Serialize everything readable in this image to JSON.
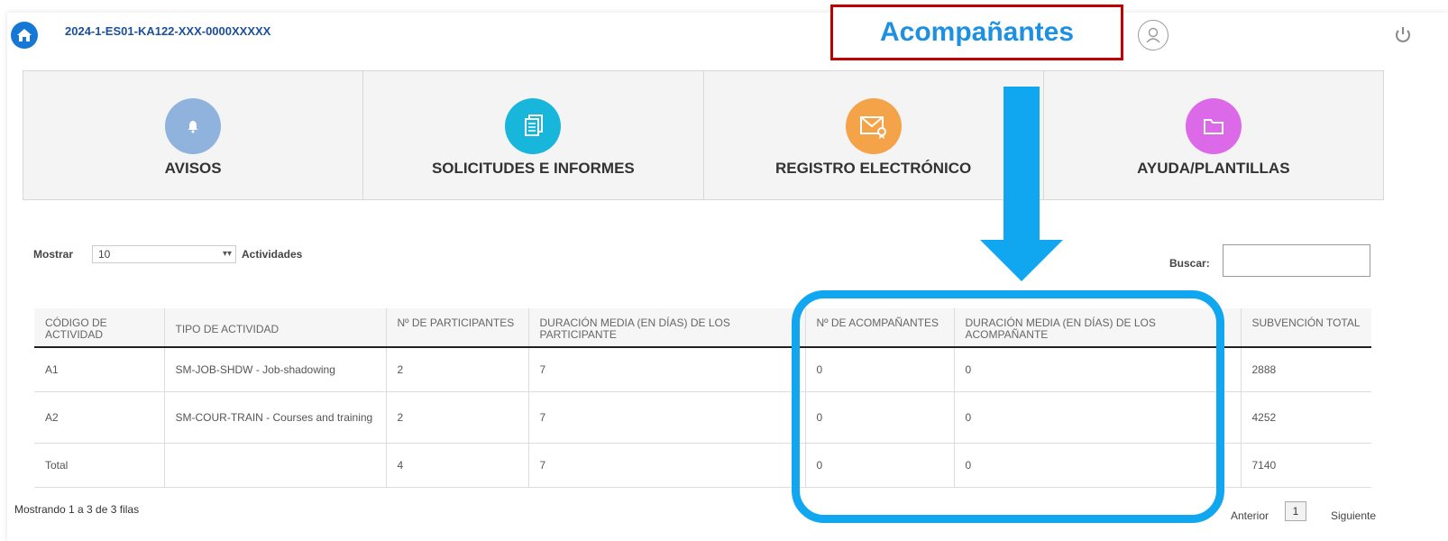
{
  "header": {
    "project_code": "2024-1-ES01-KA122-XXX-0000XXXXX",
    "annotation_title": "Acompañantes"
  },
  "tiles": [
    {
      "label": "AVISOS",
      "icon": "bell-icon",
      "color": "#8fb3dc"
    },
    {
      "label": "SOLICITUDES E INFORMES",
      "icon": "documents-icon",
      "color": "#19b6dc"
    },
    {
      "label": "REGISTRO ELECTRÓNICO",
      "icon": "mail-certificate-icon",
      "color": "#f5a349"
    },
    {
      "label": "AYUDA/PLANTILLAS",
      "icon": "folder-icon",
      "color": "#dc6ae8"
    }
  ],
  "controls": {
    "show_label": "Mostrar",
    "show_value": "10",
    "show_suffix": "Actividades",
    "search_label": "Buscar:",
    "search_value": ""
  },
  "table": {
    "headers": [
      "CÓDIGO DE ACTIVIDAD",
      "TIPO DE ACTIVIDAD",
      "Nº DE PARTICIPANTES",
      "DURACIÓN MEDIA (EN DÍAS) DE LOS PARTICIPANTE",
      "Nº DE ACOMPAÑANTES",
      "DURACIÓN MEDIA (EN DÍAS) DE LOS ACOMPAÑANTE",
      "SUBVENCIÓN TOTAL"
    ],
    "rows": [
      [
        "A1",
        "SM-JOB-SHDW - Job-shadowing",
        "2",
        "7",
        "0",
        "0",
        "2888"
      ],
      [
        "A2",
        "SM-COUR-TRAIN - Courses and training",
        "2",
        "7",
        "0",
        "0",
        "4252"
      ],
      [
        "Total",
        "",
        "4",
        "7",
        "0",
        "0",
        "7140"
      ]
    ]
  },
  "footer": {
    "info": "Mostrando 1 a 3 de 3 filas",
    "prev": "Anterior",
    "page": "1",
    "next": "Siguiente"
  },
  "colors": {
    "annotation_border": "#c00000",
    "annotation_text": "#1e90e0",
    "highlight_blue": "#10a6f0",
    "home_button": "#1478d4"
  }
}
